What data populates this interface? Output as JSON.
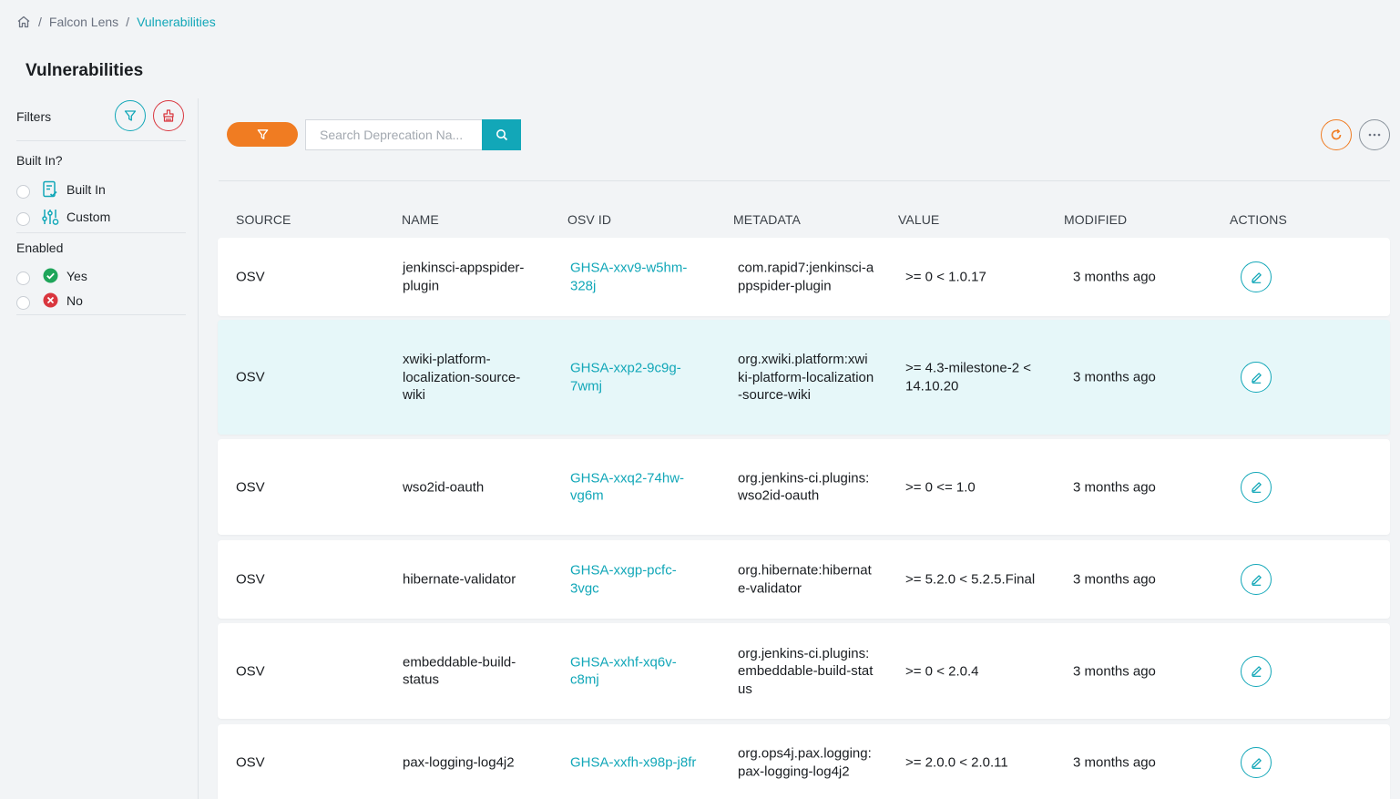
{
  "breadcrumb": {
    "root": "Falcon Lens",
    "current": "Vulnerabilities",
    "separator": "/"
  },
  "page": {
    "title": "Vulnerabilities"
  },
  "sidebar": {
    "filters_label": "Filters",
    "built_in_group": {
      "title": "Built In?",
      "options": [
        "Built In",
        "Custom"
      ]
    },
    "enabled_group": {
      "title": "Enabled",
      "options": [
        "Yes",
        "No"
      ]
    }
  },
  "search": {
    "placeholder": "Search Deprecation Na..."
  },
  "colors": {
    "accent": "#12a7b8",
    "orange": "#f07c22",
    "danger": "#d9363e",
    "success": "#1fa55a"
  },
  "table": {
    "headers": {
      "source": "SOURCE",
      "name": "NAME",
      "osv_id": "OSV ID",
      "metadata": "METADATA",
      "value": "VALUE",
      "modified": "MODIFIED",
      "actions": "ACTIONS"
    },
    "rows": [
      {
        "source": "OSV",
        "name": "jenkinsci-appspider-plugin",
        "osv_id": "GHSA-xxv9-w5hm-328j",
        "metadata": "com.rapid7:jenkinsci-appspider-plugin",
        "value": ">= 0 < 1.0.17",
        "modified": "3 months ago"
      },
      {
        "source": "OSV",
        "name": "xwiki-platform-localization-source-wiki",
        "osv_id": "GHSA-xxp2-9c9g-7wmj",
        "metadata": "org.xwiki.platform:xwiki-platform-localization-source-wiki",
        "value": ">= 4.3-milestone-2 < 14.10.20",
        "modified": "3 months ago"
      },
      {
        "source": "OSV",
        "name": "wso2id-oauth",
        "osv_id": "GHSA-xxq2-74hw-vg6m",
        "metadata": "org.jenkins-ci.plugins:wso2id-oauth",
        "value": ">= 0 <= 1.0",
        "modified": "3 months ago"
      },
      {
        "source": "OSV",
        "name": "hibernate-validator",
        "osv_id": "GHSA-xxgp-pcfc-3vgc",
        "metadata": "org.hibernate:hibernate-validator",
        "value": ">= 5.2.0 < 5.2.5.Final",
        "modified": "3 months ago"
      },
      {
        "source": "OSV",
        "name": "embeddable-build-status",
        "osv_id": "GHSA-xxhf-xq6v-c8mj",
        "metadata": "org.jenkins-ci.plugins:embeddable-build-status",
        "value": ">= 0 < 2.0.4",
        "modified": "3 months ago"
      },
      {
        "source": "OSV",
        "name": "pax-logging-log4j2",
        "osv_id": "GHSA-xxfh-x98p-j8fr",
        "metadata": "org.ops4j.pax.logging:pax-logging-log4j2",
        "value": ">= 2.0.0 < 2.0.11",
        "modified": "3 months ago"
      }
    ]
  }
}
